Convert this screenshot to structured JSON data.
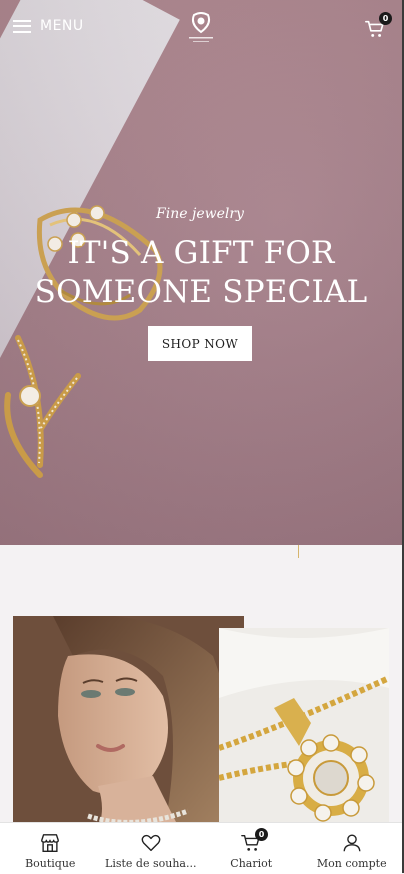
{
  "header": {
    "menu_label": "MENU",
    "cart_count": "0"
  },
  "hero": {
    "subtitle": "Fine jewelry",
    "headline_line1": "IT'S A GIFT FOR",
    "headline_line2": "SOMEONE SPECIAL",
    "cta_label": "SHOP NOW"
  },
  "bottom_nav": {
    "items": [
      {
        "label": "Boutique",
        "icon": "store-icon"
      },
      {
        "label": "Liste de souha...",
        "icon": "heart-icon"
      },
      {
        "label": "Chariot",
        "icon": "cart-icon",
        "badge": "0"
      },
      {
        "label": "Mon compte",
        "icon": "user-icon"
      }
    ]
  },
  "colors": {
    "hero_background": "#a6808a",
    "cta_background": "#ffffff",
    "badge_background": "#1a1a1a",
    "gold_accent": "#d6b56d"
  }
}
